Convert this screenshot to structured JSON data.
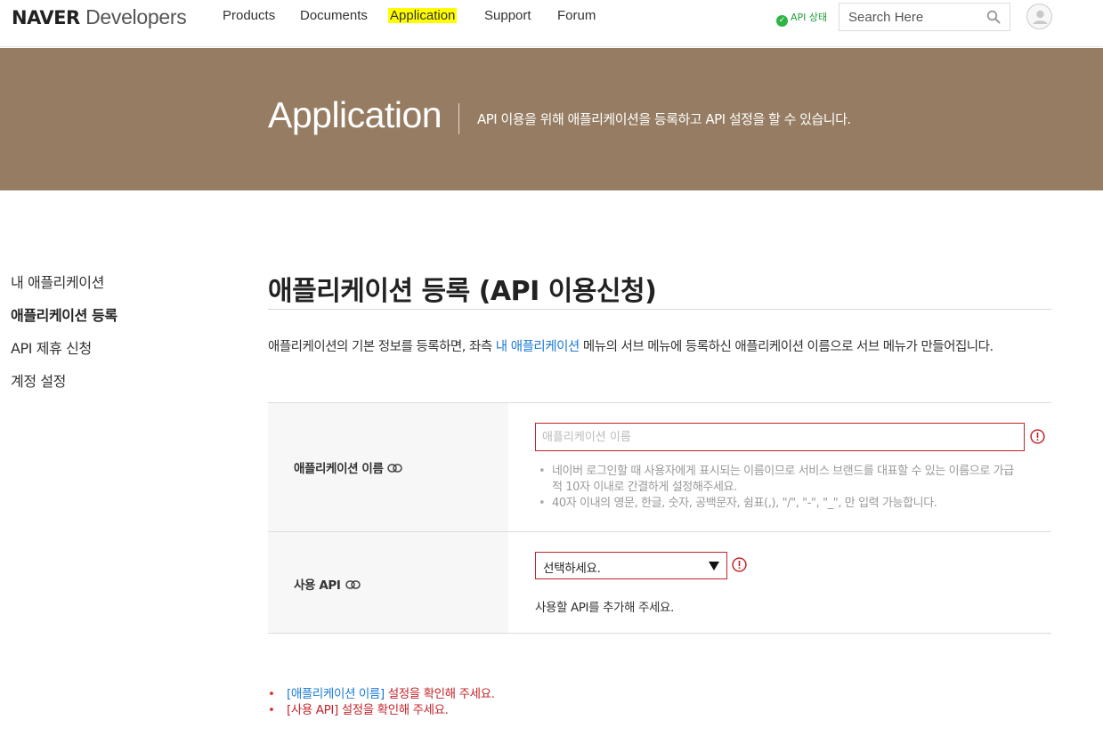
{
  "header": {
    "logo_bold": "NAVER",
    "logo_light": "Developers",
    "nav": [
      "Products",
      "Documents",
      "Application",
      "Support",
      "Forum"
    ],
    "active_nav": "Application",
    "api_status_label": "API 상태",
    "api_status_color": "#2fb344",
    "search_placeholder": "Search Here"
  },
  "banner": {
    "title": "Application",
    "description": "API 이용을 위해 애플리케이션을 등록하고 API 설정을 할 수 있습니다.",
    "background": "#967c62"
  },
  "sidebar": {
    "items": [
      "내 애플리케이션",
      "애플리케이션 등록",
      "API 제휴 신청",
      "계정 설정"
    ],
    "active": "애플리케이션 등록"
  },
  "main": {
    "title": "애플리케이션 등록 (API 이용신청)",
    "intro_before": "애플리케이션의 기본 정보를 등록하면, 좌측 ",
    "intro_link": "내 애플리케이션",
    "intro_after": " 메뉴의 서브 메뉴에 등록하신 애플리케이션 이름으로 서브 메뉴가 만들어집니다.",
    "form": {
      "name_label": "애플리케이션 이름",
      "name_placeholder": "애플리케이션 이름",
      "name_value": "",
      "name_help": [
        "네이버 로그인할 때 사용자에게 표시되는 이름이므로 서비스 브랜드를 대표할 수 있는 이름으로 가급적 10자 이내로 간결하게 설정해주세요.",
        "40자 이내의 영문, 한글, 숫자, 공백문자, 쉼표(,), \"/\", \"-\", \"_\", 만 입력 가능합니다."
      ],
      "api_label": "사용 API",
      "api_select_value": "선택하세요.",
      "api_hint": "사용할 API를 추가해 주세요."
    },
    "errors": [
      {
        "field": "[애플리케이션 이름]",
        "message": " 설정을 확인해 주세요."
      },
      {
        "field": "[사용 API]",
        "message": " 설정을 확인해 주세요."
      }
    ],
    "error_color": "#c4242b",
    "link_color": "#1a7ad8"
  }
}
